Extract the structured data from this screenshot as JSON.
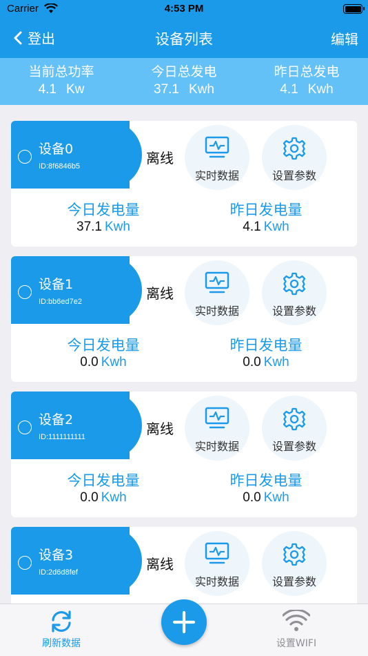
{
  "status_bar": {
    "carrier": "Carrier",
    "time": "4:53 PM"
  },
  "nav": {
    "back_label": "登出",
    "title": "设备列表",
    "edit_label": "编辑"
  },
  "summary": [
    {
      "label": "当前总功率",
      "value": "4.1",
      "unit": "Kw"
    },
    {
      "label": "今日总发电",
      "value": "37.1",
      "unit": "Kwh"
    },
    {
      "label": "昨日总发电",
      "value": "4.1",
      "unit": "Kwh"
    }
  ],
  "card_labels": {
    "realtime": "实时数据",
    "settings": "设置参数",
    "today": "今日发电量",
    "yesterday": "昨日发电量",
    "unit": "Kwh"
  },
  "devices": [
    {
      "name": "设备0",
      "id": "ID:8f6846b5",
      "status": "离线",
      "today": "37.1",
      "yesterday": "4.1"
    },
    {
      "name": "设备1",
      "id": "ID:bb6ed7e2",
      "status": "离线",
      "today": "0.0",
      "yesterday": "0.0"
    },
    {
      "name": "设备2",
      "id": "ID:1111111111",
      "status": "离线",
      "today": "0.0",
      "yesterday": "0.0"
    },
    {
      "name": "设备3",
      "id": "ID:2d6d8fef",
      "status": "离线",
      "today": "",
      "yesterday": ""
    }
  ],
  "tabbar": {
    "refresh_label": "刷新数据",
    "wifi_label": "设置WIFI"
  },
  "colors": {
    "primary": "#1a9ae8",
    "summary_bg": "#63c1f8",
    "page_bg": "#eeeef3",
    "inactive": "#8f8f94"
  },
  "icons": [
    "wifi-signal-icon",
    "battery-icon",
    "chevron-left-icon",
    "monitor-pulse-icon",
    "gear-icon",
    "refresh-icon",
    "plus-icon",
    "wifi-icon"
  ]
}
